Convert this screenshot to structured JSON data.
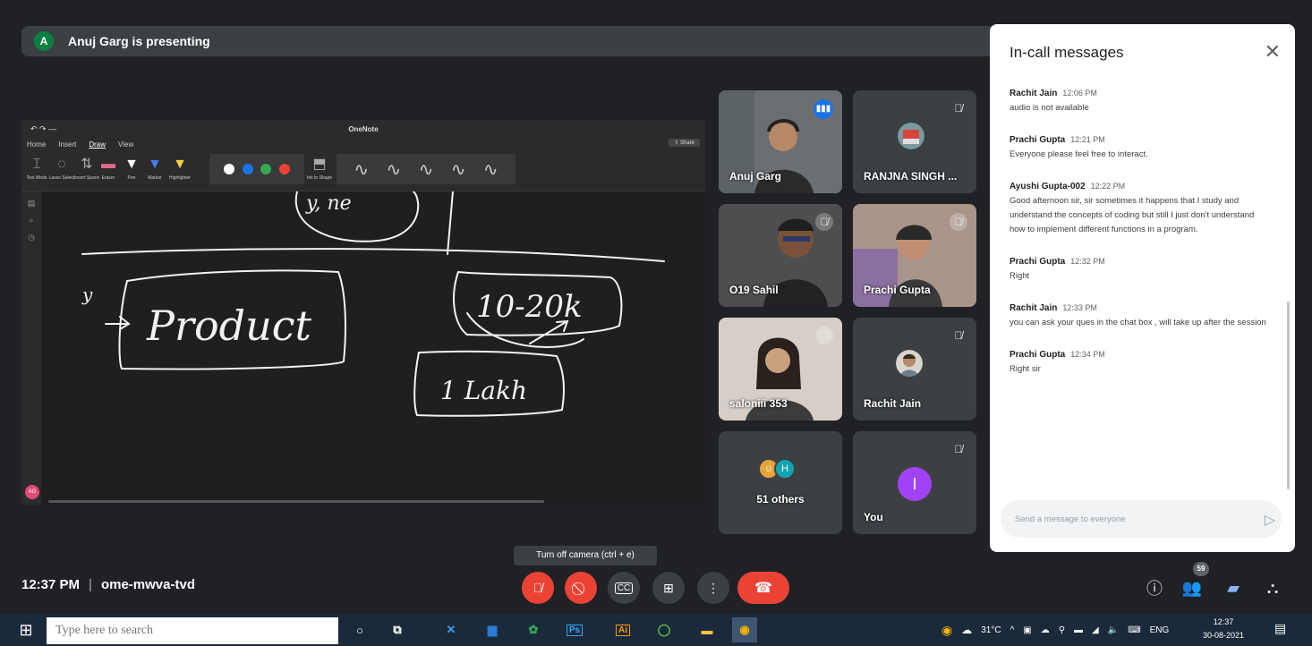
{
  "presenter": {
    "avatar_letter": "A",
    "text": "Anuj Garg is presenting"
  },
  "shared_screen": {
    "app_title": "OneNote",
    "menu": [
      "Home",
      "Insert",
      "Draw",
      "View"
    ],
    "share_label": "Share",
    "tools": [
      "Text Mode",
      "Lasso Select",
      "Insert Space",
      "Eraser",
      "Pen",
      "Marker",
      "Highlighter"
    ],
    "ink_to_shape": "Ink to Shape",
    "pen_colors": [
      "#ffffff",
      "#1a73e8",
      "#34a853",
      "#ea4335"
    ],
    "stroke_sizes": [
      "0.25 mm",
      "0.35 mm",
      "0.5 mm",
      "0.7 mm",
      "1 mm"
    ],
    "user_initials": "AG",
    "handwriting": {
      "top": "y, ne",
      "product": "Product",
      "range": "10-20k",
      "lakh": "1 Lakh"
    }
  },
  "participants": [
    {
      "name": "Anuj Garg",
      "status": "speaking",
      "kind": "video"
    },
    {
      "name": "RANJNA SINGH ...",
      "status": "muted",
      "kind": "avatar"
    },
    {
      "name": "O19 Sahil",
      "status": "muted",
      "kind": "video"
    },
    {
      "name": "Prachi Gupta",
      "status": "muted",
      "kind": "video"
    },
    {
      "name": "saloniii 353",
      "status": "muted",
      "kind": "video"
    },
    {
      "name": "Rachit Jain",
      "status": "muted",
      "kind": "avatar"
    },
    {
      "name": "51 others",
      "status": "",
      "kind": "group",
      "initial": "H"
    },
    {
      "name": "You",
      "status": "muted",
      "kind": "letter",
      "initial": "I"
    }
  ],
  "chat": {
    "title": "In-call messages",
    "messages": [
      {
        "sender": "Rachit Jain",
        "time": "12:06 PM",
        "text": "audio is not available"
      },
      {
        "sender": "Prachi Gupta",
        "time": "12:21 PM",
        "text": "Everyone please feel free to interact."
      },
      {
        "sender": "Ayushi Gupta-002",
        "time": "12:22 PM",
        "text": "Good afternoon sir, sir sometimes it happens that I study and understand the concepts of coding but still I just don't understand how to implement different functions in a program."
      },
      {
        "sender": "Prachi Gupta",
        "time": "12:32 PM",
        "text": "Right"
      },
      {
        "sender": "Rachit Jain",
        "time": "12:33 PM",
        "text": "you can ask your ques in the chat box , will take up after the session"
      },
      {
        "sender": "Prachi Gupta",
        "time": "12:34 PM",
        "text": "Right sir"
      }
    ],
    "input_placeholder": "Send a message to everyone"
  },
  "tooltip": "Turn off camera (ctrl + e)",
  "meeting": {
    "time": "12:37 PM",
    "separator": "|",
    "code": "ome-mwva-tvd"
  },
  "people_count": "59",
  "taskbar": {
    "search_placeholder": "Type here to search",
    "weather": "31°C",
    "language": "ENG",
    "clock_time": "12:37",
    "clock_date": "30-08-2021"
  }
}
